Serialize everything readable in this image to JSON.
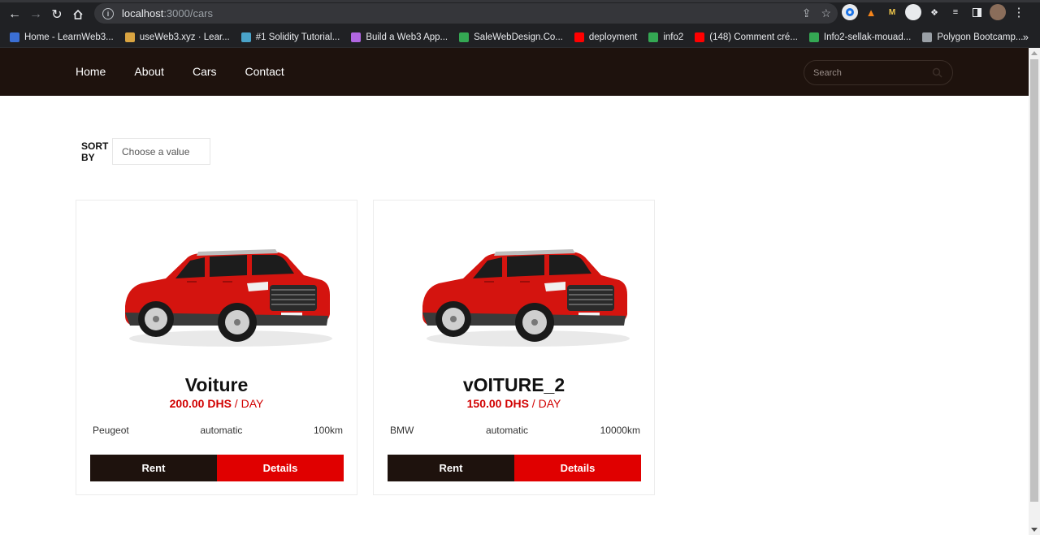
{
  "browser": {
    "url_host": "localhost",
    "url_path": ":3000/cars",
    "bookmarks": [
      {
        "label": "Home - LearnWeb3...",
        "color": "#3b6fd4",
        "icon": "diamond-icon"
      },
      {
        "label": "useWeb3.xyz · Lear...",
        "color": "#d9a441",
        "icon": "tools-icon"
      },
      {
        "label": "#1 Solidity Tutorial...",
        "color": "#4aa3c9",
        "icon": "solidity-icon"
      },
      {
        "label": "Build a Web3 App...",
        "color": "#b066e0",
        "icon": "unicorn-icon"
      },
      {
        "label": "SaleWebDesign.Co...",
        "color": "#34a853",
        "icon": "drive-icon"
      },
      {
        "label": "deployment",
        "color": "#ff0000",
        "icon": "youtube-icon"
      },
      {
        "label": "info2",
        "color": "#34a853",
        "icon": "drive-icon"
      },
      {
        "label": "(148) Comment cré...",
        "color": "#ff0000",
        "icon": "youtube-icon"
      },
      {
        "label": "Info2-sellak-mouad...",
        "color": "#34a853",
        "icon": "drive-icon"
      },
      {
        "label": "Polygon Bootcamp...",
        "color": "#9aa0a6",
        "icon": "polygon-icon"
      }
    ]
  },
  "nav": {
    "links": [
      "Home",
      "About",
      "Cars",
      "Contact"
    ],
    "search_placeholder": "Search"
  },
  "sort": {
    "label": "SORT BY",
    "placeholder": "Choose a value"
  },
  "cars": [
    {
      "name": "Voiture",
      "price": "200.00 DHS",
      "per": " / DAY",
      "brand": "Peugeot",
      "transmission": "automatic",
      "mileage": "100km",
      "rent_label": "Rent",
      "details_label": "Details"
    },
    {
      "name": "vOITURE_2",
      "price": "150.00 DHS",
      "per": " / DAY",
      "brand": "BMW",
      "transmission": "automatic",
      "mileage": "10000km",
      "rent_label": "Rent",
      "details_label": "Details"
    }
  ],
  "colors": {
    "nav_bg": "#1e120d",
    "accent_red": "#e00000",
    "price_red": "#d10000"
  }
}
